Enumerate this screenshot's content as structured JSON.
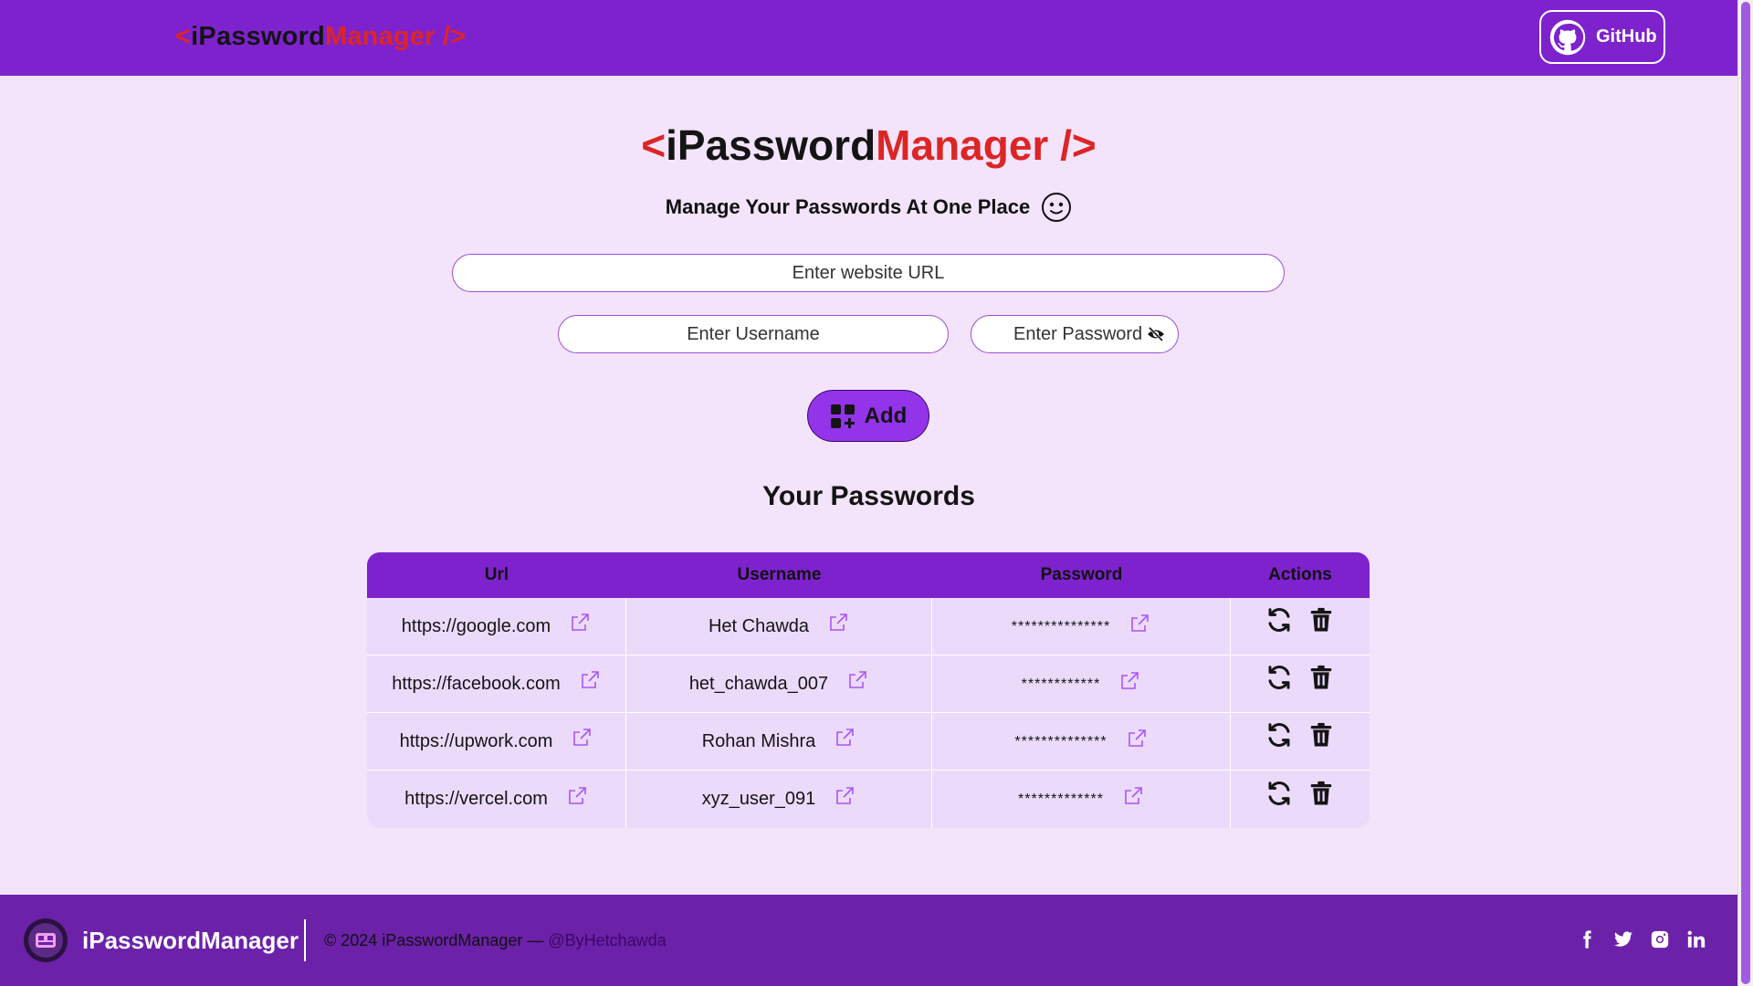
{
  "header": {
    "brand": {
      "open": "<",
      "name": "iPassword",
      "accent": "Manager",
      "close": " />"
    },
    "github_label": "GitHub"
  },
  "hero": {
    "brand": {
      "open": "<",
      "name": "iPassword",
      "accent": "Manager",
      "close": " />"
    },
    "tagline": "Manage Your Passwords At One Place"
  },
  "form": {
    "url_placeholder": "Enter website URL",
    "username_placeholder": "Enter Username",
    "password_placeholder": "Enter Password",
    "add_label": "Add"
  },
  "passwords": {
    "title": "Your Passwords",
    "columns": [
      "Url",
      "Username",
      "Password",
      "Actions"
    ],
    "rows": [
      {
        "url": "https://google.com",
        "username": "Het Chawda",
        "password": "***************"
      },
      {
        "url": "https://facebook.com",
        "username": "het_chawda_007",
        "password": "************"
      },
      {
        "url": "https://upwork.com",
        "username": "Rohan Mishra",
        "password": "**************"
      },
      {
        "url": "https://vercel.com",
        "username": "xyz_user_091",
        "password": "*************"
      }
    ]
  },
  "footer": {
    "brand": "iPasswordManager",
    "copyright": "© 2024 iPasswordManager — ",
    "handle": "@ByHetchawda",
    "social_icons": [
      "facebook-icon",
      "twitter-icon",
      "instagram-icon",
      "linkedin-icon"
    ]
  },
  "colors": {
    "primary": "#7e22ce",
    "accent_red": "#dc2626",
    "background": "#f3e4fb",
    "footer": "#6b21a8"
  }
}
